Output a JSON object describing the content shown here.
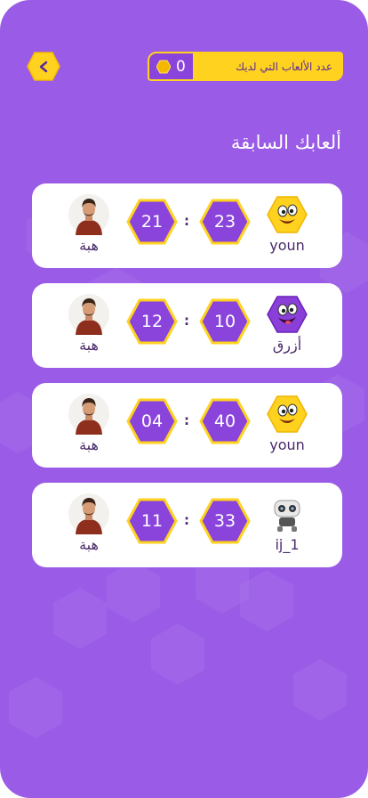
{
  "header": {
    "games_label": "عدد الألعاب التي لديك",
    "games_count": "0"
  },
  "page_title": "ألعابك السابقة",
  "games": [
    {
      "right_player": "youn",
      "right_score": "23",
      "left_score": "21",
      "left_player": "هبة",
      "separator": ":",
      "right_avatar": "yellow-emoji"
    },
    {
      "right_player": "أزرق",
      "right_score": "10",
      "left_score": "12",
      "left_player": "هبة",
      "separator": ":",
      "right_avatar": "purple-emoji"
    },
    {
      "right_player": "youn",
      "right_score": "40",
      "left_score": "04",
      "left_player": "هبة",
      "separator": ":",
      "right_avatar": "yellow-emoji"
    },
    {
      "right_player": "ij_1",
      "right_score": "33",
      "left_score": "11",
      "left_player": "هبة",
      "separator": ":",
      "right_avatar": "robot"
    }
  ],
  "colors": {
    "background": "#9a5ce6",
    "accent": "#ffd21f",
    "hex_fill": "#8a44dc",
    "card": "#ffffff"
  }
}
